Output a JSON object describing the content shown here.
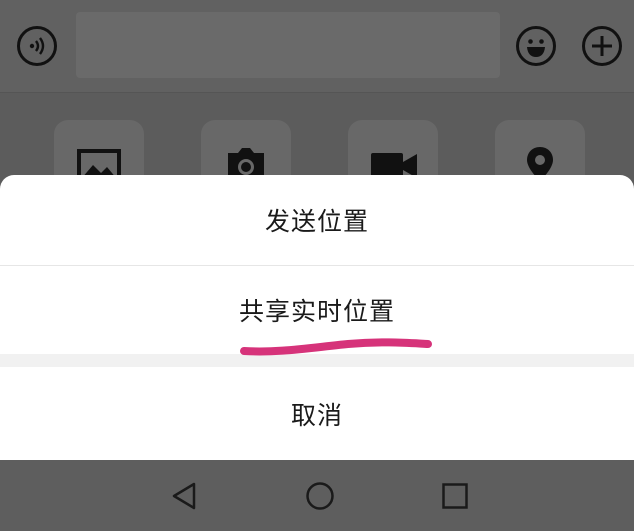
{
  "input_bar": {
    "voice_icon": "voice-input-icon",
    "emoji_icon": "emoji-icon",
    "plus_icon": "plus-icon"
  },
  "attachments": [
    {
      "icon": "image-icon"
    },
    {
      "icon": "camera-icon"
    },
    {
      "icon": "video-icon"
    },
    {
      "icon": "location-pin-icon"
    }
  ],
  "action_sheet": {
    "send_location": "发送位置",
    "share_realtime_location": "共享实时位置",
    "cancel": "取消",
    "highlight_color": "#d6337a"
  },
  "nav_bar": {
    "back_icon": "back-triangle-icon",
    "home_icon": "home-circle-icon",
    "recent_icon": "recent-apps-square-icon"
  }
}
